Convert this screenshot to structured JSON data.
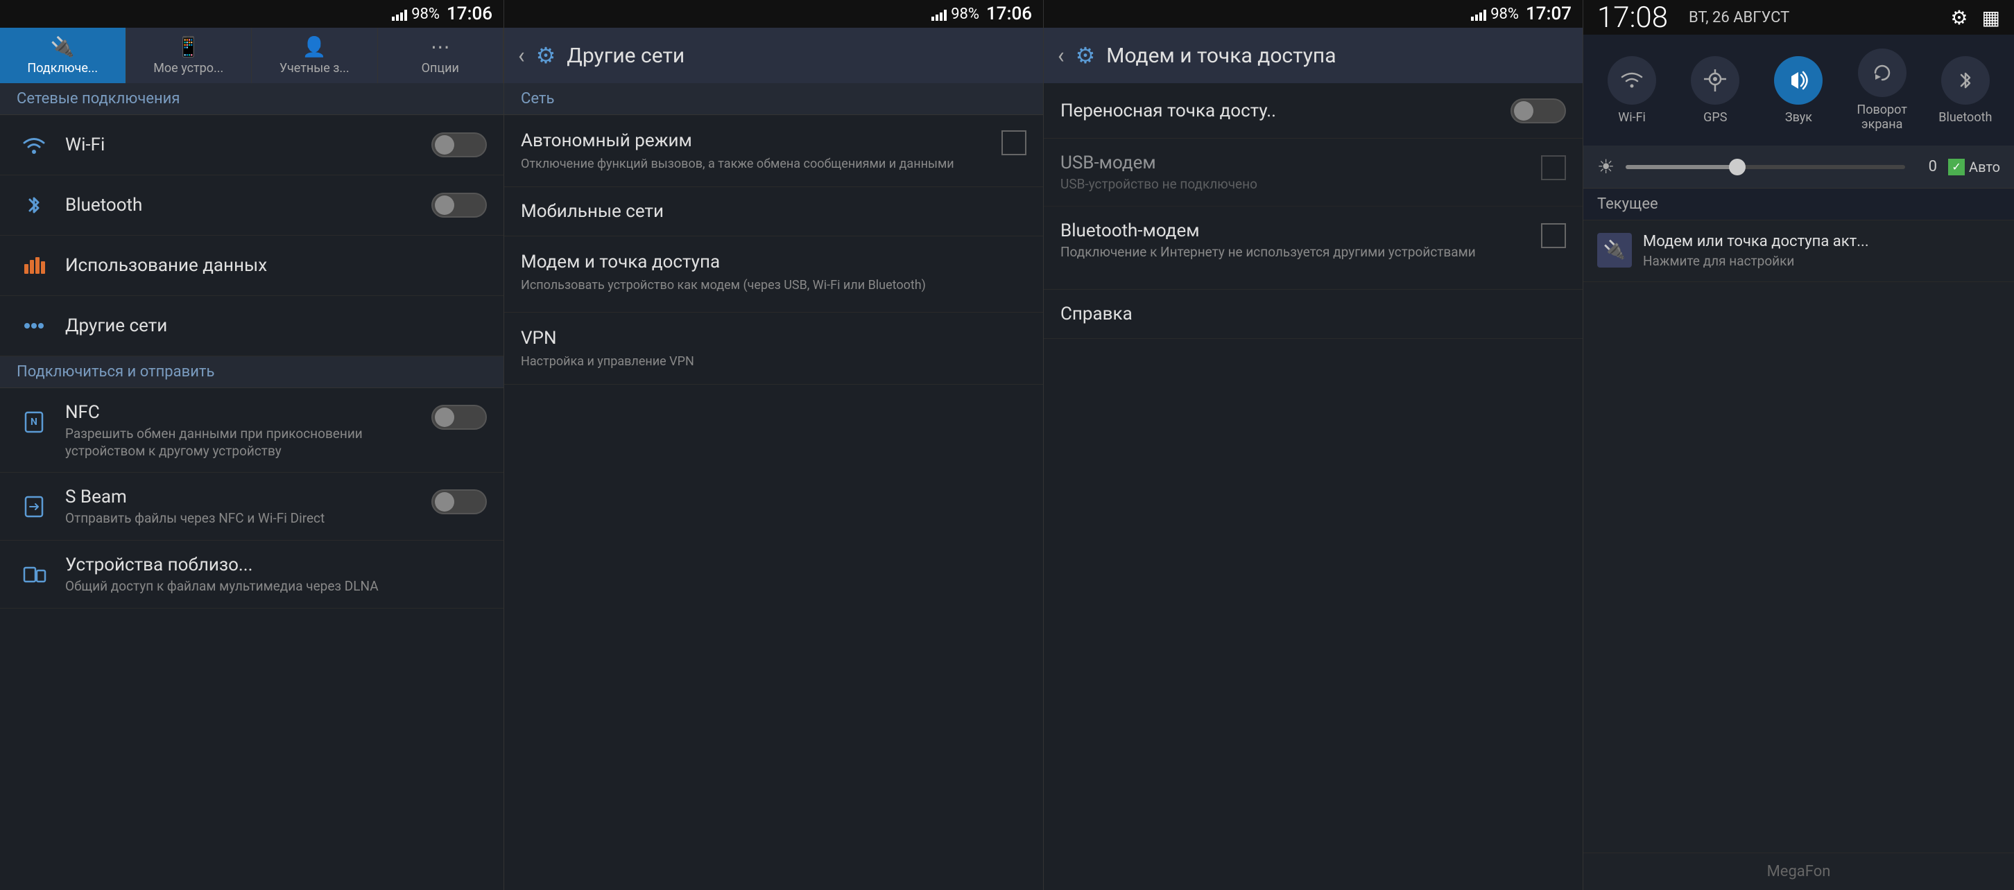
{
  "panel1": {
    "statusBar": {
      "signal": "98%",
      "time": "17:06",
      "battery": "98%"
    },
    "tabs": [
      {
        "label": "Подключе...",
        "icon": "🔌",
        "active": true
      },
      {
        "label": "Мое устро...",
        "icon": "📱",
        "active": false
      },
      {
        "label": "Учетные з...",
        "icon": "👤",
        "active": false
      },
      {
        "label": "Опции",
        "icon": "⋯",
        "active": false
      }
    ],
    "sectionHeader": "Сетевые подключения",
    "items": [
      {
        "icon": "wifi",
        "title": "Wi-Fi",
        "subtitle": "",
        "hasToggle": true,
        "toggleOn": false
      },
      {
        "icon": "bluetooth",
        "title": "Bluetooth",
        "subtitle": "",
        "hasToggle": true,
        "toggleOn": false
      },
      {
        "icon": "data",
        "title": "Использование данных",
        "subtitle": "",
        "hasToggle": false,
        "toggleOn": false
      },
      {
        "icon": "other",
        "title": "Другие сети",
        "subtitle": "",
        "hasToggle": false,
        "toggleOn": false
      }
    ],
    "section2Header": "Подключиться и отправить",
    "items2": [
      {
        "icon": "nfc",
        "title": "NFC",
        "subtitle": "Разрешить обмен данными при прикосновении устройством к другому устройству",
        "hasToggle": true,
        "toggleOn": false
      },
      {
        "icon": "sbeam",
        "title": "S Beam",
        "subtitle": "Отправить файлы через NFC и Wi-Fi Direct",
        "hasToggle": true,
        "toggleOn": false
      },
      {
        "icon": "nearby",
        "title": "Устройства поблизо...",
        "subtitle": "Общий доступ к файлам мультимедиа через DLNA",
        "hasToggle": false,
        "toggleOn": false
      }
    ]
  },
  "panel2": {
    "statusBar": {
      "signal": "98%",
      "time": "17:06"
    },
    "header": {
      "title": "Другие сети",
      "icon": "⚙"
    },
    "sectionHeader": "Сеть",
    "items": [
      {
        "title": "Автономный режим",
        "subtitle": "Отключение функций вызовов, а также обмена сообщениями и данными",
        "hasCheckbox": true
      },
      {
        "title": "Мобильные сети",
        "subtitle": "",
        "hasCheckbox": false
      },
      {
        "title": "Модем и точка доступа",
        "subtitle": "Использовать устройство как модем (через USB, Wi-Fi или Bluetooth)",
        "hasCheckbox": false
      },
      {
        "title": "VPN",
        "subtitle": "Настройка и управление VPN",
        "hasCheckbox": false
      }
    ]
  },
  "panel3": {
    "statusBar": {
      "signal": "98%",
      "time": "17:07"
    },
    "header": {
      "title": "Модем и точка доступа",
      "icon": "⚙"
    },
    "items": [
      {
        "title": "Переносная точка досту..",
        "subtitle": "",
        "hasToggle": true,
        "toggleOn": false
      },
      {
        "title": "USB-модем",
        "subtitle": "USB-устройство не подключено",
        "hasCheckbox": true,
        "checkboxOn": false,
        "disabled": true
      },
      {
        "title": "Bluetooth-модем",
        "subtitle": "Подключение к Интернету не используется другими устройствами",
        "hasCheckbox": true,
        "checkboxOn": false
      },
      {
        "title": "Справка",
        "subtitle": "",
        "hasCheckbox": false
      }
    ]
  },
  "panel4": {
    "time": "17:08",
    "date": "ВТ, 26 АВГУСТ",
    "quickTiles": [
      {
        "label": "Wi-Fi",
        "icon": "wifi",
        "active": false
      },
      {
        "label": "GPS",
        "icon": "gps",
        "active": false
      },
      {
        "label": "Звук",
        "icon": "sound",
        "active": true
      },
      {
        "label": "Поворот экрана",
        "icon": "rotate",
        "active": false
      },
      {
        "label": "Bluetooth",
        "icon": "bluetooth",
        "active": false
      }
    ],
    "brightness": {
      "value": "0",
      "autoLabel": "Авто",
      "autoEnabled": true
    },
    "currentSection": "Текущее",
    "notifications": [
      {
        "icon": "usb",
        "title": "Модем или точка доступа акт...",
        "subtitle": "Нажмите для настройки"
      }
    ],
    "carrier": "MegaFon"
  }
}
